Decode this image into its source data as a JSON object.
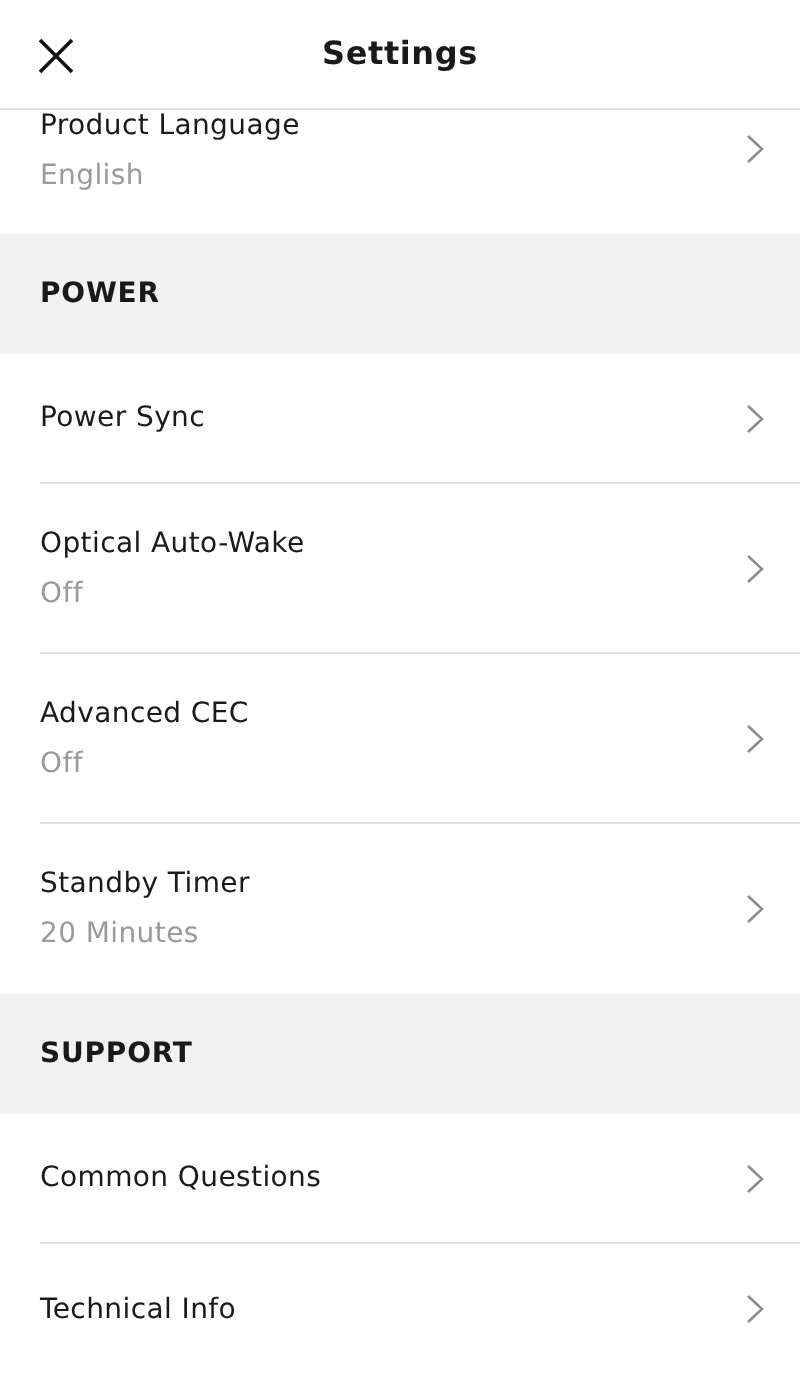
{
  "header": {
    "title": "Settings"
  },
  "sections": [
    {
      "items": [
        {
          "label": "Product Language",
          "value": "English"
        }
      ]
    },
    {
      "title": "POWER",
      "items": [
        {
          "label": "Power Sync"
        },
        {
          "label": "Optical Auto-Wake",
          "value": "Off"
        },
        {
          "label": "Advanced CEC",
          "value": "Off"
        },
        {
          "label": "Standby Timer",
          "value": "20 Minutes"
        }
      ]
    },
    {
      "title": "SUPPORT",
      "items": [
        {
          "label": "Common Questions"
        },
        {
          "label": "Technical Info"
        }
      ]
    }
  ]
}
